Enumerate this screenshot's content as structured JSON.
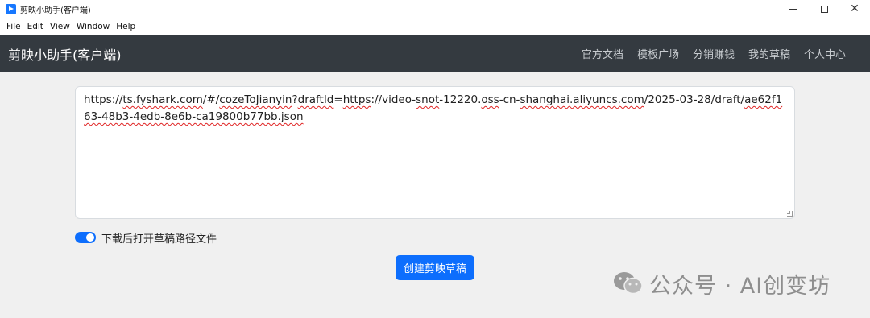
{
  "window": {
    "title": "剪映小助手(客户端)",
    "controls": {
      "minimize_icon": "minimize-icon",
      "maximize_icon": "maximize-icon",
      "close_icon": "close-icon",
      "close_glyph": "✕"
    }
  },
  "menubar": {
    "items": [
      "File",
      "Edit",
      "View",
      "Window",
      "Help"
    ]
  },
  "navbar": {
    "brand": "剪映小助手(客户端)",
    "links": [
      "官方文档",
      "模板广场",
      "分销赚钱",
      "我的草稿",
      "个人中心"
    ]
  },
  "main": {
    "url_input": {
      "value_segments": [
        {
          "text": "https://",
          "spell": false
        },
        {
          "text": "ts.fyshark.com",
          "spell": true
        },
        {
          "text": "/#/",
          "spell": false
        },
        {
          "text": "cozeToJianyin",
          "spell": true
        },
        {
          "text": "?",
          "spell": false
        },
        {
          "text": "draftId",
          "spell": true
        },
        {
          "text": "=",
          "spell": false
        },
        {
          "text": "https",
          "spell": true
        },
        {
          "text": "://video-",
          "spell": false
        },
        {
          "text": "snot",
          "spell": true
        },
        {
          "text": "-12220.",
          "spell": false
        },
        {
          "text": "oss",
          "spell": true
        },
        {
          "text": "-cn-",
          "spell": false
        },
        {
          "text": "shanghai.aliyuncs.com",
          "spell": true
        },
        {
          "text": "/2025-03-28/draft/",
          "spell": false
        },
        {
          "text": "ae62f163-48b3-4edb-8e6b-ca19800b77bb.json",
          "spell": true
        }
      ]
    },
    "toggle": {
      "label": "下载后打开草稿路径文件",
      "checked": true
    },
    "create_button": "创建剪映草稿"
  },
  "watermark": {
    "text": "公众号 · AI创变坊",
    "icon": "wechat-icon"
  },
  "colors": {
    "navbar_bg": "#343a40",
    "accent": "#0d6efd",
    "page_bg": "#f0f0f0"
  }
}
